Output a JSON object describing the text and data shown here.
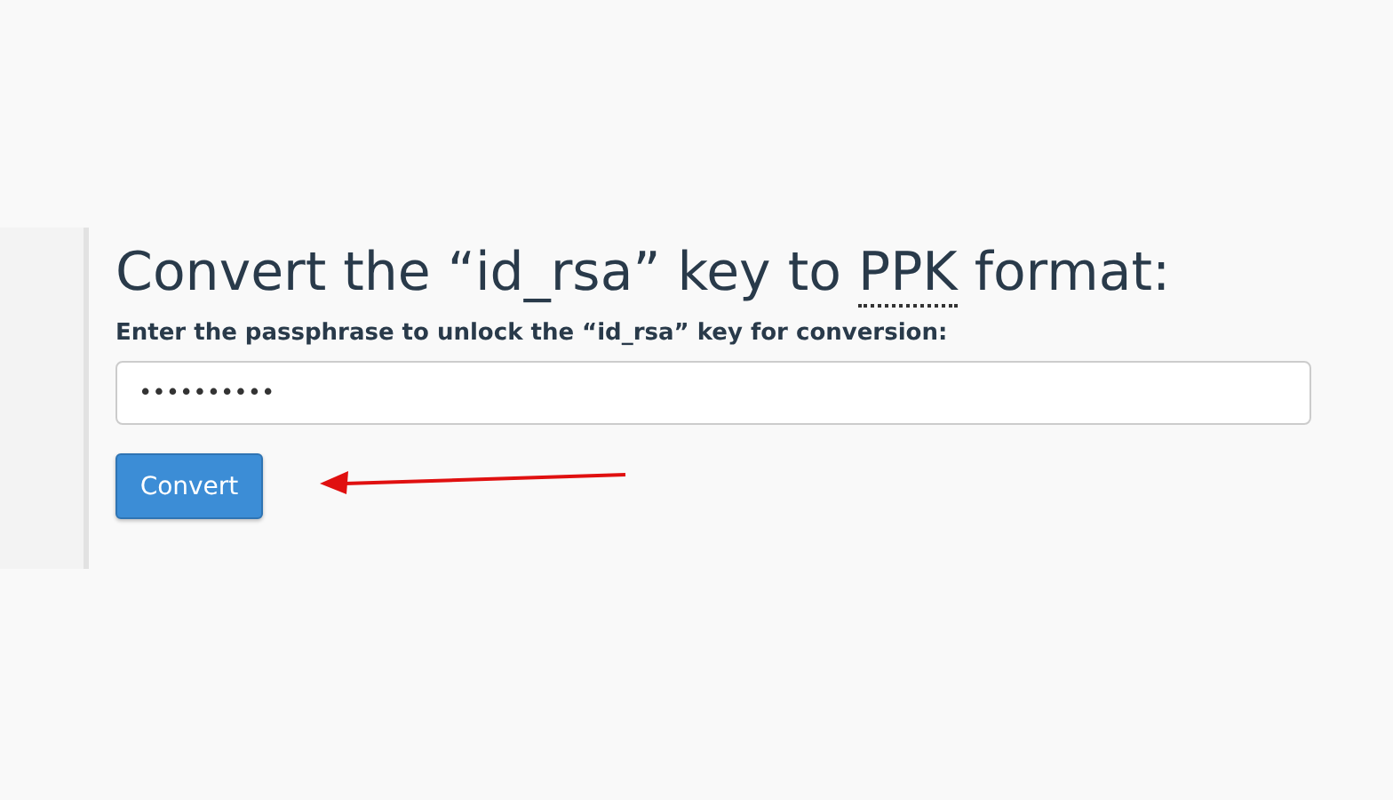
{
  "heading": {
    "text_before": "Convert the “id_rsa” key to ",
    "abbreviation": "PPK",
    "text_after": " format:"
  },
  "passphrase_field": {
    "label": "Enter the passphrase to unlock the “id_rsa” key for conversion:",
    "value": "••••••••••"
  },
  "convert_button": {
    "label": "Convert"
  },
  "annotation": {
    "kind": "arrow"
  }
}
